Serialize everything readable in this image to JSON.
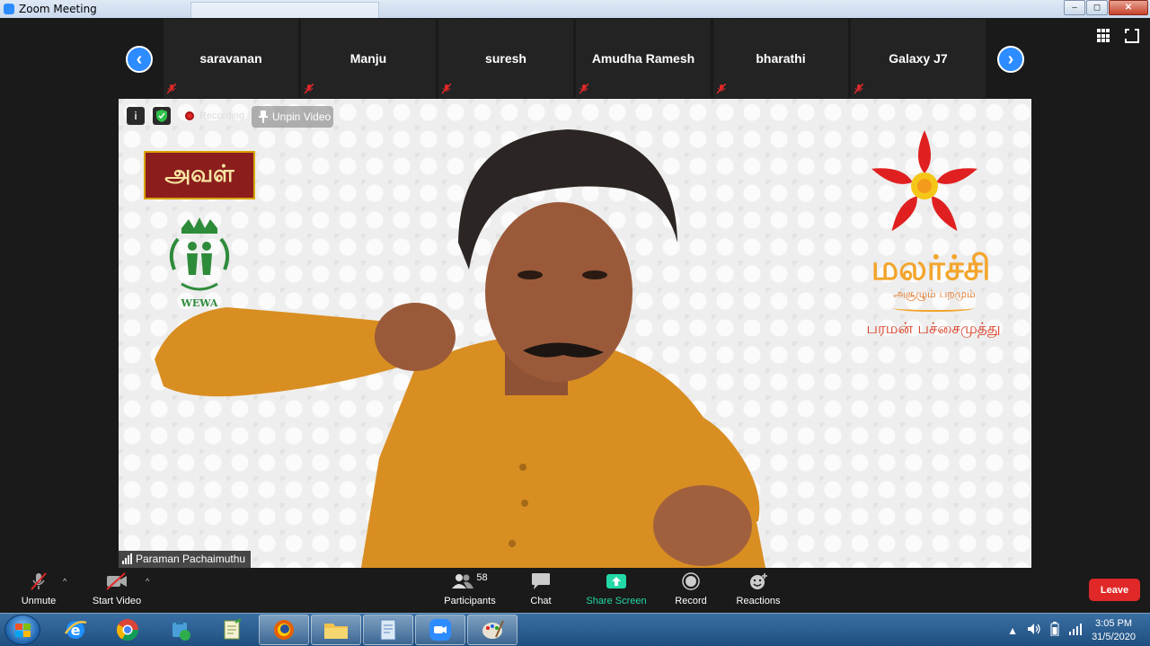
{
  "window": {
    "title": "Zoom Meeting",
    "minimize": "‒",
    "maximize": "◻",
    "close": "✕"
  },
  "strip": {
    "prev_label": "‹",
    "next_label": "›",
    "participants": [
      {
        "name": "saravanan"
      },
      {
        "name": "Manju"
      },
      {
        "name": "suresh"
      },
      {
        "name": "Amudha Ramesh"
      },
      {
        "name": "bharathi"
      },
      {
        "name": "Galaxy J7"
      }
    ]
  },
  "video": {
    "info_icon": "i",
    "recording_label": "Recording",
    "unpin_label": "Unpin Video",
    "speaker_name": "Paraman Pachaimuthu",
    "logos": {
      "aval_text": "அவள்",
      "wewa_text": "WEWA",
      "brand_title": "மலர்ச்சி",
      "brand_tagline": "அசூழும் பறமும்",
      "brand_person": "பரமன் பச்சைமுத்து"
    },
    "colors": {
      "flower_red": "#e02020",
      "flower_center": "#f5c518",
      "brand_orange": "#f3a52b"
    }
  },
  "toolbar": {
    "unmute_label": "Unmute",
    "start_video_label": "Start Video",
    "participants_label": "Participants",
    "participants_count": "58",
    "chat_label": "Chat",
    "share_label": "Share Screen",
    "record_label": "Record",
    "reactions_label": "Reactions",
    "leave_label": "Leave",
    "caret": "^",
    "colors": {
      "share_green": "#23d9a7",
      "leave_red": "#e02828"
    }
  },
  "taskbar": {
    "apps": [
      "internet-explorer",
      "chrome",
      "network-tool",
      "notepad-plus",
      "firefox",
      "file-explorer",
      "document-viewer",
      "zoom",
      "paint"
    ],
    "time": "3:05 PM",
    "date": "31/5/2020"
  }
}
